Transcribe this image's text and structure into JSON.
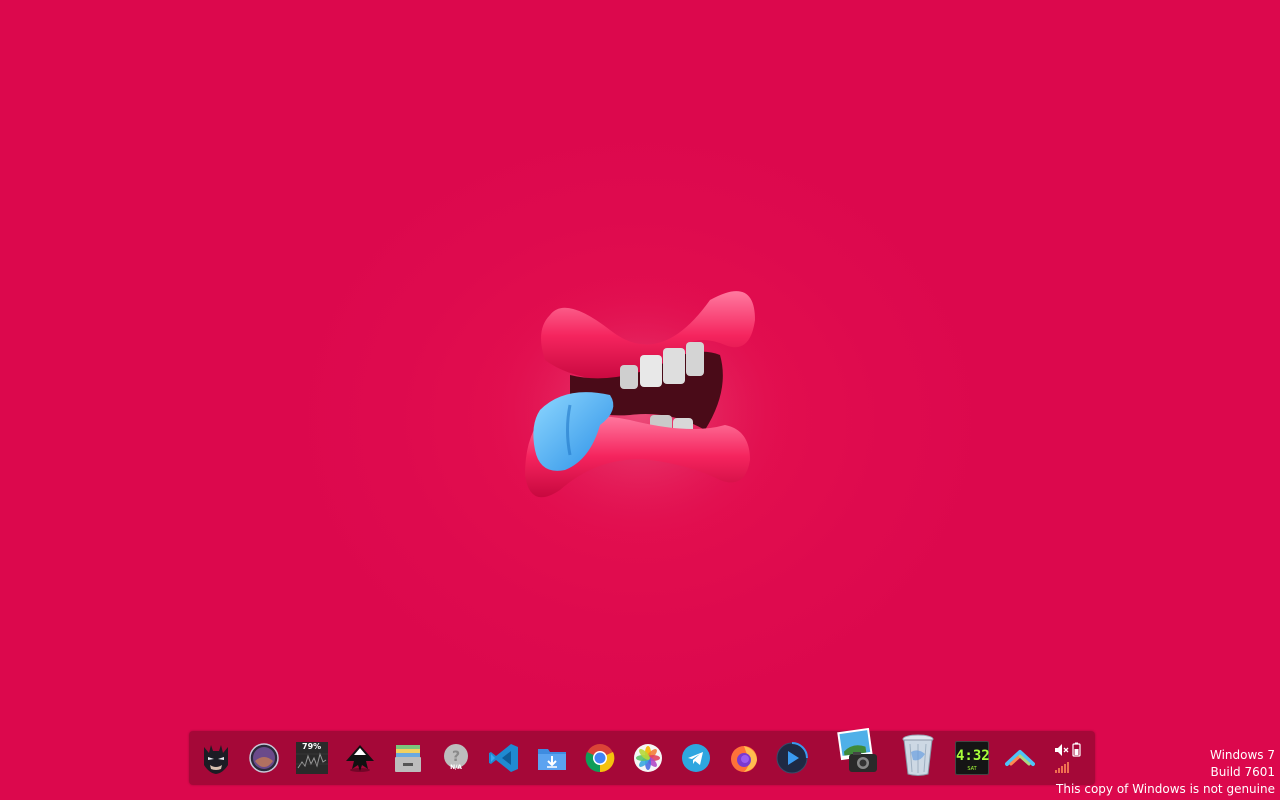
{
  "desktop": {
    "background_color": "#de0a4e",
    "wallpaper_art": "cartoon-lips-with-blue-tongue"
  },
  "dock": {
    "items": [
      {
        "name": "batman-icon",
        "label": ""
      },
      {
        "name": "macos-launcher-icon",
        "label": ""
      },
      {
        "name": "cpu-meter-icon",
        "label": "79%"
      },
      {
        "name": "inkscape-icon",
        "label": ""
      },
      {
        "name": "archive-manager-icon",
        "label": ""
      },
      {
        "name": "weather-unavailable-icon",
        "label": "N/A"
      },
      {
        "name": "vscode-icon",
        "label": ""
      },
      {
        "name": "downloads-folder-icon",
        "label": ""
      },
      {
        "name": "chrome-icon",
        "label": ""
      },
      {
        "name": "photos-icon",
        "label": ""
      },
      {
        "name": "telegram-icon",
        "label": ""
      },
      {
        "name": "firefox-icon",
        "label": ""
      },
      {
        "name": "media-player-icon",
        "label": ""
      },
      {
        "name": "image-viewer-icon",
        "label": ""
      },
      {
        "name": "recycle-bin-icon",
        "label": ""
      },
      {
        "name": "digital-clock-icon",
        "label": "4:32",
        "sublabel": "SAT"
      },
      {
        "name": "app-launcher-icon",
        "label": ""
      },
      {
        "name": "system-tray-icon",
        "label": ""
      }
    ]
  },
  "watermark": {
    "line1": "Windows 7",
    "line2": "Build 7601",
    "line3": "This copy of Windows is not genuine"
  }
}
